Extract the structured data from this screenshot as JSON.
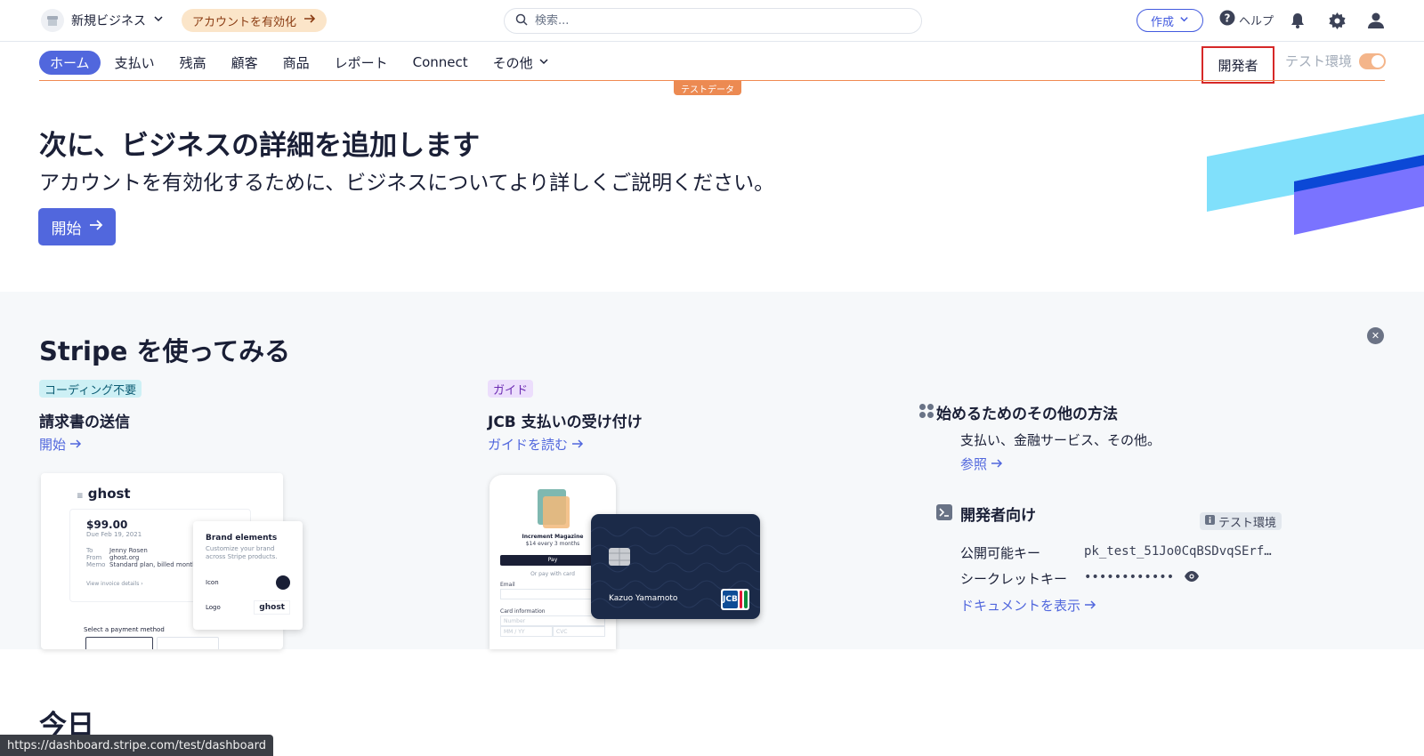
{
  "topbar": {
    "business_name": "新規ビジネス",
    "activate_label": "アカウントを有効化",
    "search_placeholder": "検索...",
    "create_label": "作成",
    "help_label": "ヘルプ"
  },
  "nav": {
    "items": [
      "ホーム",
      "支払い",
      "残高",
      "顧客",
      "商品",
      "レポート",
      "Connect",
      "その他"
    ],
    "developer_label": "開発者",
    "test_mode_label": "テスト環境",
    "test_data_badge": "テストデータ"
  },
  "hero": {
    "title": "次に、ビジネスの詳細を追加します",
    "subtitle": "アカウントを有効化するために、ビジネスについてより詳しくご説明ください。",
    "start_label": "開始"
  },
  "getting_started": {
    "title": "Stripe を使ってみる",
    "card1": {
      "badge": "コーディング不要",
      "title": "請求書の送信",
      "link": "開始"
    },
    "card2": {
      "badge": "ガイド",
      "title": "JCB 支払いの受け付け",
      "link": "ガイドを読む"
    },
    "other": {
      "title": "始めるためのその他の方法",
      "desc": "支払い、金融サービス、その他。",
      "link": "参照"
    },
    "dev": {
      "title": "開発者向け",
      "env_badge": "テスト環境",
      "public_key_label": "公開可能キー",
      "public_key_value": "pk_test_51Jo0CqBSDvqSErf…",
      "secret_key_label": "シークレットキー",
      "secret_key_value": "••••••••••••",
      "docs_link": "ドキュメントを表示"
    }
  },
  "invoice_mock": {
    "brand": "ghost",
    "amount": "$99.00",
    "due": "Due Feb 19, 2021",
    "to_label": "To",
    "to_value": "Jenny Rosen",
    "from_label": "From",
    "from_value": "ghost.org",
    "memo_label": "Memo",
    "memo_value": "Standard plan, billed monthly",
    "view_details": "View invoice details",
    "payment_method": "Select a payment method",
    "brand_elements_title": "Brand elements",
    "brand_elements_desc": "Customize your brand across Stripe products.",
    "icon_label": "Icon",
    "logo_label": "Logo",
    "logo_value": "ghost"
  },
  "jcb_mock": {
    "magazine": "Increment Magazine",
    "price": "$14 every 3 months",
    "pay_button": "Pay",
    "or_card": "Or pay with card",
    "email_label": "Email",
    "card_info": "Card information",
    "number_placeholder": "Number",
    "expiry_placeholder": "MM / YY",
    "cvc_placeholder": "CVC",
    "cardholder": "Kazuo Yamamoto",
    "card_brand": "JCB"
  },
  "today": {
    "title": "今日"
  },
  "status_bar": {
    "url": "https://dashboard.stripe.com/test/dashboard"
  },
  "colors": {
    "accent": "#5167dd",
    "test_orange": "#ec8a52",
    "dev_highlight": "#d62828"
  }
}
